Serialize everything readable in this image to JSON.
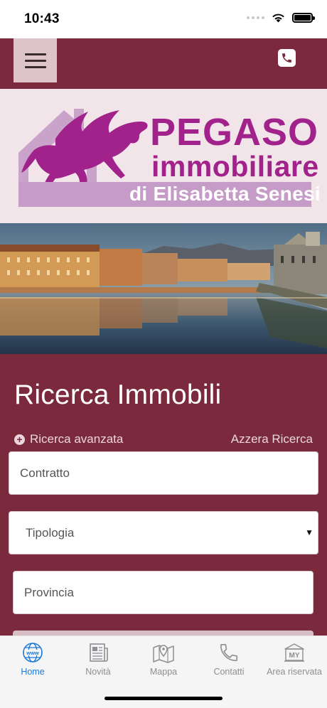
{
  "status_bar": {
    "time": "10:43",
    "battery_level": 1.0
  },
  "header": {
    "menu_icon": "hamburger-menu-icon",
    "phone_icon": "phone-icon",
    "colors": {
      "bar": "#7b2a3d",
      "menu_button": "#dcc4c9"
    }
  },
  "brand": {
    "name": "PEGASO",
    "subtitle": "immobiliare",
    "owner": "di Elisabetta Senesi",
    "colors": {
      "primary": "#a0228a",
      "banner": "#c59bc8",
      "house": "#c9a3c9"
    }
  },
  "hero": {
    "image": "river-city-panorama"
  },
  "search": {
    "title": "Ricerca Immobili",
    "advanced_label": "Ricerca avanzata",
    "reset_label": "Azzera Ricerca",
    "contract_placeholder": "Contratto",
    "type_select": "Tipologia",
    "province_placeholder": "Provincia"
  },
  "tab_bar": {
    "tabs": [
      {
        "label": "Home",
        "icon": "globe-www-icon",
        "active": true
      },
      {
        "label": "Novità",
        "icon": "newspaper-icon",
        "active": false
      },
      {
        "label": "Mappa",
        "icon": "map-pin-icon",
        "active": false
      },
      {
        "label": "Contatti",
        "icon": "phone-icon",
        "active": false
      },
      {
        "label": "Area riservata",
        "icon": "my-area-icon",
        "active": false
      }
    ],
    "colors": {
      "active": "#1d79d8",
      "inactive": "#8e8e93"
    }
  }
}
